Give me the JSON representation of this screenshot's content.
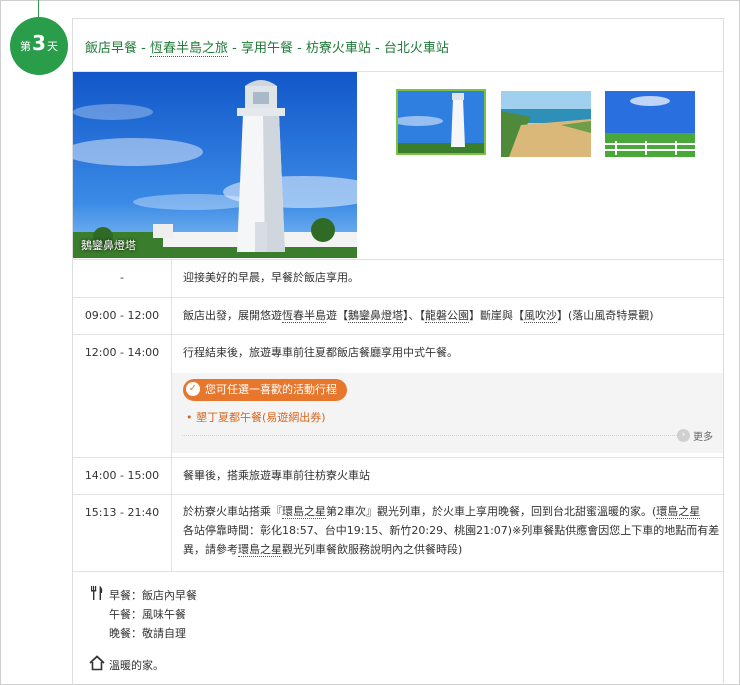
{
  "day": {
    "prefix": "第",
    "number": "3",
    "suffix": "天"
  },
  "title": {
    "part1": "飯店早餐 - ",
    "link1": "恆春半島之旅",
    "part2": " - 享用午餐 - 枋寮火車站 - 台北火車站"
  },
  "hero": {
    "caption": "鵝鑾鼻燈塔"
  },
  "thumbnails": [
    "lighthouse-thumb",
    "coast-thumb",
    "grassland-thumb"
  ],
  "itinerary": [
    {
      "time": "-",
      "desc": "迎接美好的早晨，早餐於飯店享用。"
    },
    {
      "time": "09:00 - 12:00",
      "d1": "飯店出發，展開悠遊",
      "l1": "恆春半島",
      "d2": "遊【",
      "l2": "鵝鑾鼻燈塔",
      "d3": "】、【",
      "l3": "龍磐公園",
      "d4": "】斷崖與【",
      "l4": "風吹沙",
      "d5": "】(落山風奇特景觀)"
    },
    {
      "time": "12:00 - 14:00",
      "desc": "行程結束後，旅遊專車前往夏都飯店餐廳享用中式午餐。",
      "option_label": "您可任選一喜歡的活動行程",
      "option_item": "墾丁夏都午餐(易遊網出券)",
      "more": "更多"
    },
    {
      "time": "14:00 - 15:00",
      "desc": "餐畢後，搭乘旅遊專車前往枋寮火車站"
    },
    {
      "time": "15:13 - 21:40",
      "a1": "於枋寮火車站搭乘『",
      "al1": "環島之星",
      "a2": "第2車次』觀光列車，於火車上享用晚餐，回到台北甜蜜溫暖的家。(",
      "al2": "環島之星",
      "b1": "各站停靠時間：彰化18:57、台中19:15、新竹20:29、桃園21:07)※列車餐點供應會因您上下車的地點而有差",
      "c1": "異，請參考",
      "cl1": "環島之星",
      "c2": "觀光列車餐飲服務說明內之供餐時段)"
    }
  ],
  "meals": {
    "breakfast": "早餐：飯店內早餐",
    "lunch": "午餐：風味午餐",
    "dinner": "晚餐：敬請自理",
    "lodging": "溫暖的家。"
  },
  "colors": {
    "brand_green": "#2a9d4a",
    "title_green": "#1e7a37",
    "option_orange": "#e8772e"
  }
}
